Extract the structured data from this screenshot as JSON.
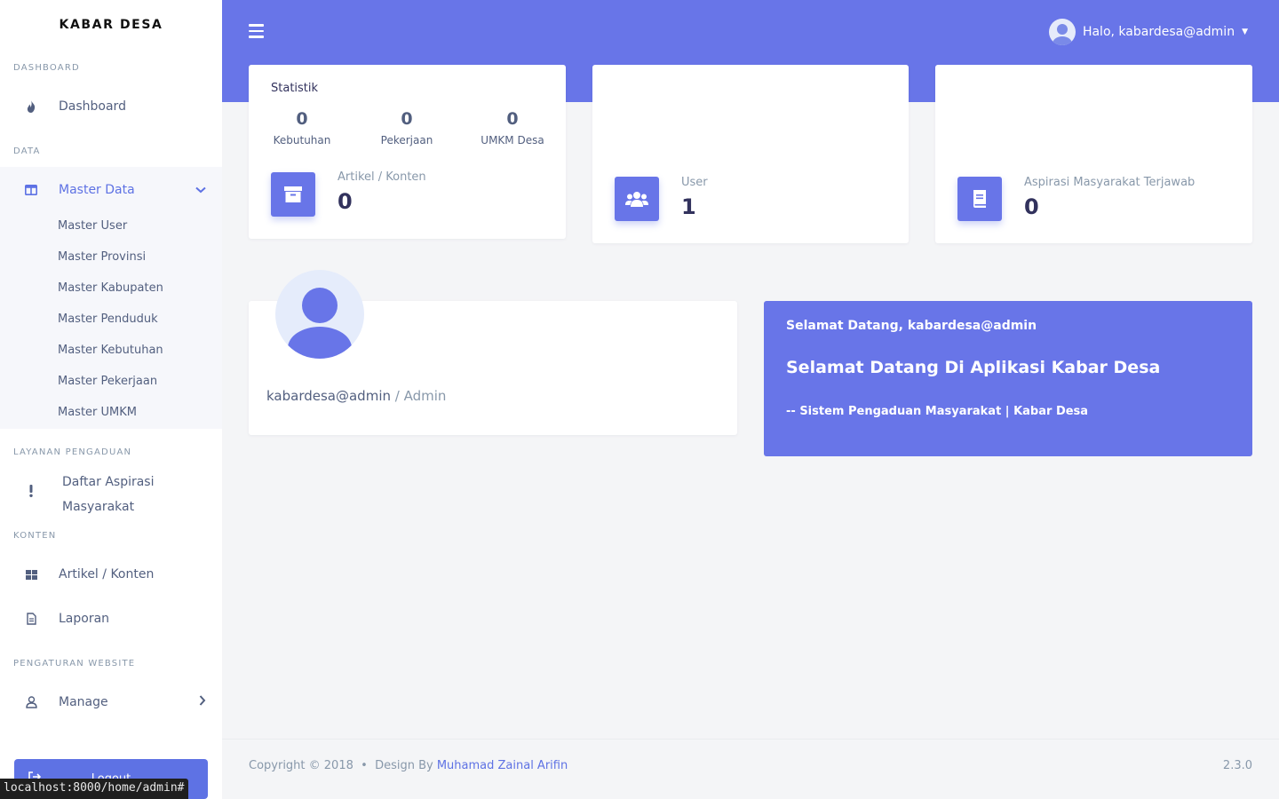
{
  "sidebar": {
    "brand": "KABAR DESA",
    "sections": {
      "dashboard": "DASHBOARD",
      "data": "DATA",
      "layanan": "LAYANAN PENGADUAN",
      "konten": "KONTEN",
      "pengaturan": "PENGATURAN WEBSITE"
    },
    "items": {
      "dashboard": "Dashboard",
      "master_data": "Master Data",
      "daftar_aspirasi_line1": "Daftar Aspirasi",
      "daftar_aspirasi_line2": "Masyarakat",
      "artikel": "Artikel / Konten",
      "laporan": "Laporan",
      "manage": "Manage"
    },
    "master_sub": [
      "Master User",
      "Master Provinsi",
      "Master Kabupaten",
      "Master Penduduk",
      "Master Kebutuhan",
      "Master Pekerjaan",
      "Master UMKM"
    ],
    "logout": "Logout"
  },
  "status_url": "localhost:8000/home/admin#",
  "header": {
    "greeting": "Halo, kabardesa@admin"
  },
  "stats": {
    "title": "Statistik",
    "kebutuhan_value": "0",
    "kebutuhan_label": "Kebutuhan",
    "pekerjaan_value": "0",
    "pekerjaan_label": "Pekerjaan",
    "umkm_value": "0",
    "umkm_label": "UMKM Desa",
    "artikel_label": "Artikel / Konten",
    "artikel_value": "0"
  },
  "user_card": {
    "label": "User",
    "value": "1"
  },
  "aspirasi_card": {
    "label": "Aspirasi Masyarakat Terjawab",
    "value": "0"
  },
  "profile": {
    "name": "kabardesa@admin",
    "role": " / Admin"
  },
  "welcome": {
    "line1": "Selamat Datang, kabardesa@admin",
    "line2": "Selamat Datang Di Aplikasi Kabar Desa",
    "line3": "-- Sistem Pengaduan Masyarakat | Kabar Desa"
  },
  "footer": {
    "copyright": "Copyright © 2018  •  Design By ",
    "author": "Muhamad Zainal Arifin",
    "version": "2.3.0"
  },
  "colors": {
    "accent": "#5e72e4",
    "band": "#6875e8"
  }
}
